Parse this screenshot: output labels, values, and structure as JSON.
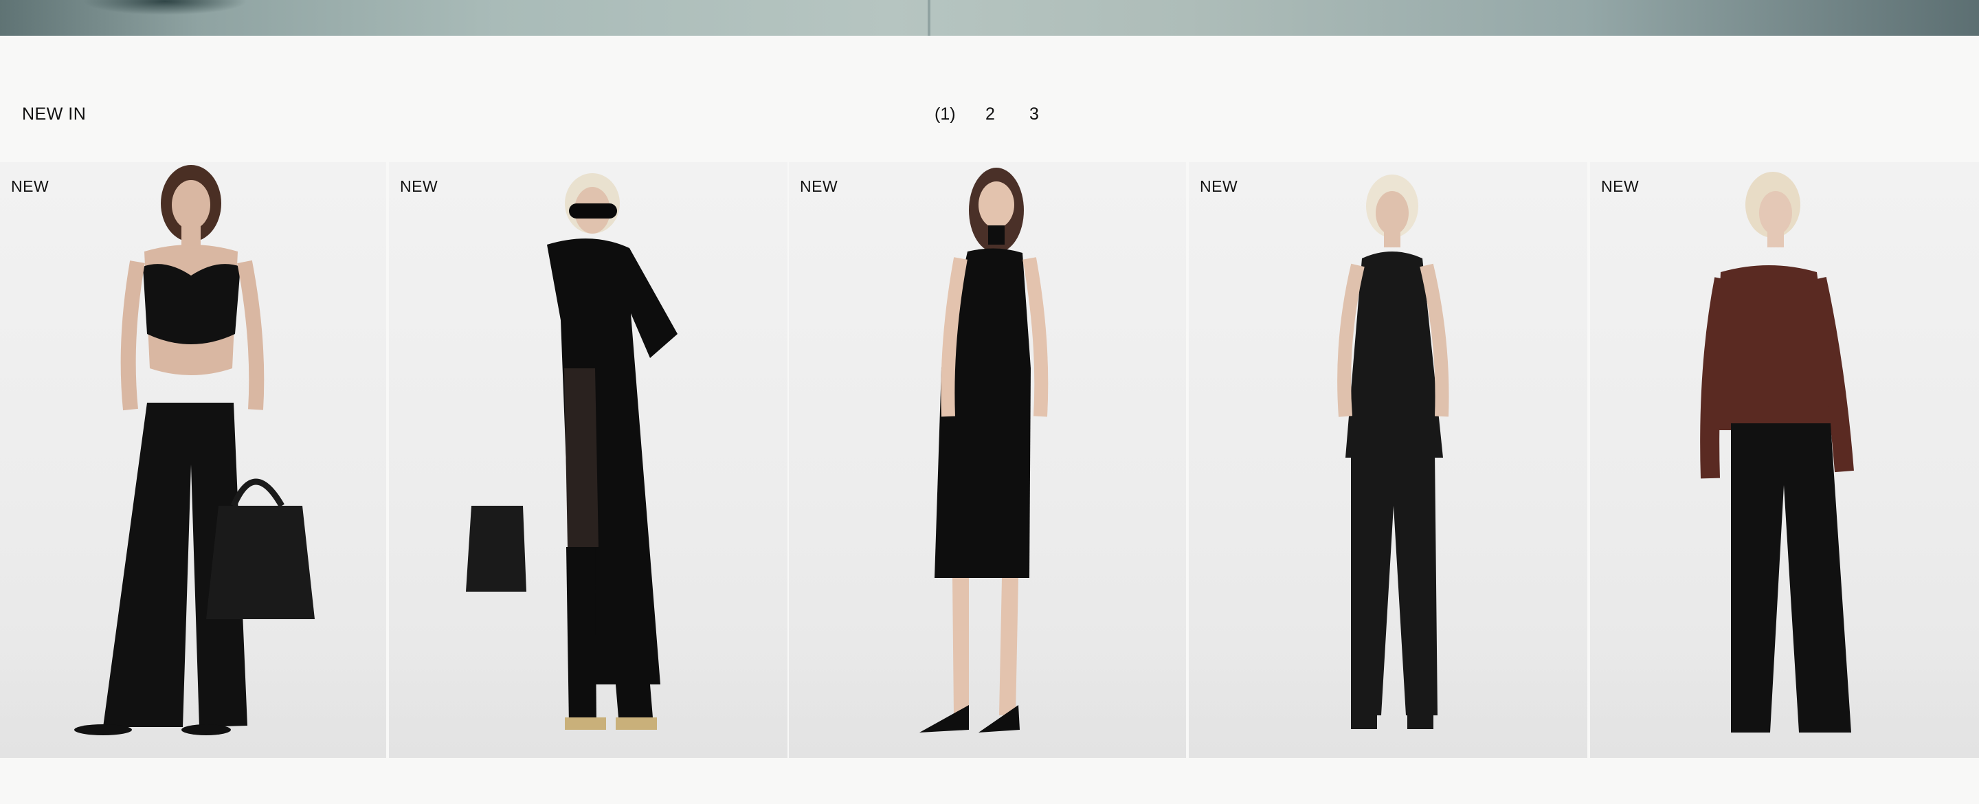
{
  "section": {
    "title": "NEW IN"
  },
  "pagination": {
    "pages": [
      "(1)",
      "2",
      "3"
    ],
    "current": "(1)"
  },
  "products": [
    {
      "badge": "NEW",
      "garment_color": "#111111",
      "skin": "#d9b7a2",
      "hair": "#4a2f24"
    },
    {
      "badge": "NEW",
      "garment_color": "#0d0d0d",
      "skin": "#e0c2ae",
      "hair": "#e9e1cf"
    },
    {
      "badge": "NEW",
      "garment_color": "#0e0e0e",
      "skin": "#e3c3ae",
      "hair": "#4a3028"
    },
    {
      "badge": "NEW",
      "garment_color": "#181818",
      "skin": "#dfc1ad",
      "hair": "#ece4d3"
    },
    {
      "badge": "NEW",
      "garment_color": "#5a2a22",
      "skin": "#e4c8b6",
      "hair": "#e8dcc6"
    }
  ],
  "colors": {
    "page_bg": "#f8f8f7",
    "photo_bg": "#efefef",
    "text": "#111111",
    "accent_top_strip": "#a9bbb8"
  }
}
